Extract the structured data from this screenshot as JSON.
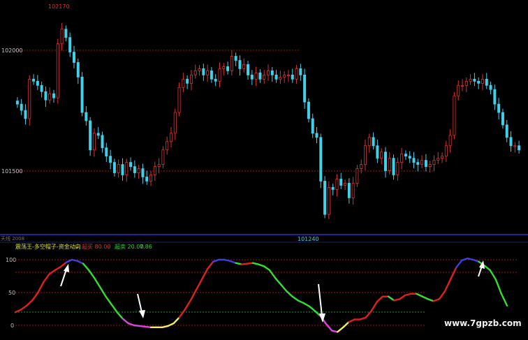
{
  "price_panel": {
    "high_label": "102170",
    "low_label": "101240",
    "y_ticks": [
      "102000",
      "101500"
    ],
    "period_label": "天线 2008"
  },
  "indicator_panel": {
    "title": "震荡王-多空帽子-资金动向",
    "overbought_label": "超买 80.00",
    "oversold_label": "超卖 20.00",
    "current_value": "7.86",
    "y_ticks": [
      "100",
      "50",
      "0"
    ]
  },
  "watermark": "www.7gpzb.com",
  "colors": {
    "up": "#e03030",
    "down": "#40d0e8",
    "osc_up": "#e02020",
    "osc_down": "#30e030",
    "ref_red": "#a01010",
    "ref_green": "#20a020",
    "divider": "#3030d0"
  },
  "chart_data": [
    {
      "type": "candlestick",
      "ylim": [
        101140,
        102240
      ],
      "reference_levels": [
        102000,
        101500
      ],
      "close": [
        101760,
        101730,
        101690,
        101880,
        101870,
        101850,
        101820,
        101780,
        101810,
        101790,
        102050,
        102120,
        102080,
        102010,
        101960,
        101890,
        101720,
        101680,
        101540,
        101620,
        101610,
        101550,
        101510,
        101480,
        101430,
        101470,
        101420,
        101480,
        101460,
        101430,
        101450,
        101410,
        101390,
        101420,
        101460,
        101470,
        101540,
        101580,
        101620,
        101720,
        101840,
        101880,
        101860,
        101900,
        101920,
        101930,
        101900,
        101920,
        101880,
        101870,
        101930,
        101940,
        101920,
        101990,
        101970,
        101930,
        101950,
        101900,
        101880,
        101910,
        101880,
        101900,
        101920,
        101900,
        101880,
        101890,
        101900,
        101900,
        101880,
        101930,
        101900,
        101770,
        101690,
        101620,
        101600,
        101390,
        101230,
        101360,
        101350,
        101400,
        101370,
        101380,
        101310,
        101380,
        101450,
        101470,
        101560,
        101600,
        101560,
        101500,
        101530,
        101440,
        101500,
        101420,
        101480,
        101520,
        101510,
        101500,
        101480,
        101470,
        101490,
        101460,
        101470,
        101490,
        101500,
        101510,
        101560,
        101610,
        101800,
        101850,
        101850,
        101870,
        101880,
        101870,
        101860,
        101880,
        101850,
        101830,
        101760,
        101720,
        101660,
        101600,
        101560,
        101560,
        101540
      ]
    },
    {
      "type": "line",
      "ylim": [
        -10,
        110
      ],
      "reference_levels": [
        80,
        20
      ],
      "values": [
        20,
        24,
        30,
        38,
        50,
        66,
        78,
        84,
        89,
        96,
        100,
        98,
        94,
        84,
        72,
        58,
        44,
        32,
        20,
        10,
        3,
        0,
        -1,
        -2,
        -3,
        -3,
        -3,
        -1,
        3,
        12,
        24,
        38,
        54,
        70,
        86,
        97,
        100,
        100,
        98,
        95,
        93,
        94,
        95,
        93,
        90,
        84,
        72,
        62,
        52,
        44,
        38,
        34,
        29,
        22,
        14,
        2,
        -8,
        -10,
        -3,
        5,
        9,
        9,
        12,
        22,
        36,
        44,
        44,
        38,
        40,
        46,
        48,
        48,
        44,
        40,
        37,
        40,
        52,
        70,
        88,
        99,
        102,
        100,
        97,
        91,
        84,
        70,
        48,
        30
      ]
    }
  ]
}
